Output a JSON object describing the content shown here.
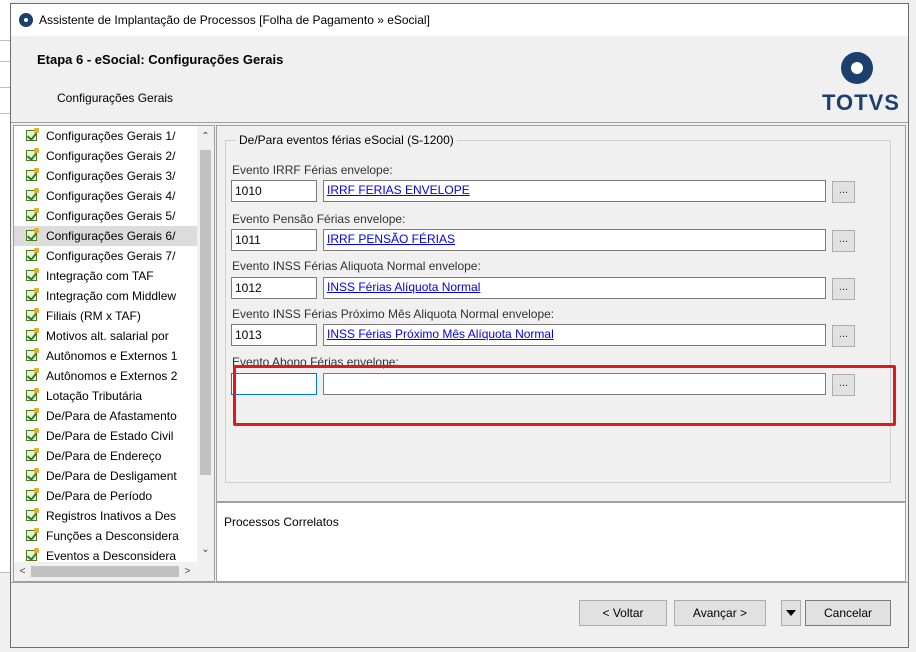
{
  "window": {
    "title": "Assistente de Implantação de Processos [Folha de Pagamento » eSocial]"
  },
  "header": {
    "step_title": "Etapa 6 - eSocial: Configurações Gerais",
    "subtitle": "Configurações Gerais",
    "logo_text": "TOTVS"
  },
  "sidebar": {
    "items": [
      {
        "label": "Configurações Gerais 1/"
      },
      {
        "label": "Configurações Gerais 2/"
      },
      {
        "label": "Configurações Gerais 3/"
      },
      {
        "label": "Configurações Gerais 4/"
      },
      {
        "label": "Configurações Gerais 5/"
      },
      {
        "label": "Configurações Gerais 6/"
      },
      {
        "label": "Configurações Gerais 7/"
      },
      {
        "label": "Integração com TAF"
      },
      {
        "label": "Integração com Middlew"
      },
      {
        "label": "Filiais (RM x TAF)"
      },
      {
        "label": "Motivos alt. salarial por"
      },
      {
        "label": "Autônomos e Externos 1"
      },
      {
        "label": "Autônomos e Externos 2"
      },
      {
        "label": "Lotação Tributária"
      },
      {
        "label": "De/Para de Afastamento"
      },
      {
        "label": "De/Para de Estado Civil"
      },
      {
        "label": "De/Para de Endereço"
      },
      {
        "label": "De/Para de Desligament"
      },
      {
        "label": "De/Para de Período"
      },
      {
        "label": "Registros Inativos a Des"
      },
      {
        "label": "Funções a Desconsidera"
      },
      {
        "label": "Eventos a Desconsidera"
      }
    ],
    "selected_label": "Configurações Gerais 6/"
  },
  "group": {
    "title": "De/Para eventos férias eSocial (S-1200)",
    "fields": [
      {
        "label": "Evento IRRF Férias envelope:",
        "code": "1010",
        "description": "IRRF FERIAS ENVELOPE"
      },
      {
        "label": "Evento Pensão Férias envelope:",
        "code": "1011",
        "description": "IRRF PENSÃO FÉRIAS"
      },
      {
        "label": "Evento INSS Férias Aliquota Normal envelope:",
        "code": "1012",
        "description": "INSS Férias Alíquota Normal"
      },
      {
        "label": "Evento INSS Férias Próximo Mês Aliquota Normal envelope:",
        "code": "1013",
        "description": "INSS Férias Próximo Mês Alíquota Normal"
      },
      {
        "label": "Evento Abono Férias envelope:",
        "code": "",
        "description": ""
      }
    ],
    "lookup_label": "..."
  },
  "correlatos": {
    "title": "Processos Correlatos"
  },
  "buttons": {
    "back": "< Voltar",
    "next": "Avançar >",
    "cancel": "Cancelar"
  },
  "colors": {
    "highlight": "#e0191c",
    "brand": "#1c3f70",
    "link": "#0000ee"
  }
}
